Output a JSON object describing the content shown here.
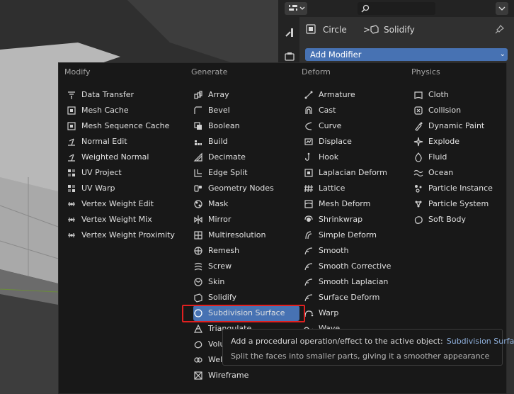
{
  "header": {
    "editor_type_icon": "properties-editor-icon",
    "search_placeholder": ""
  },
  "breadcrumb": {
    "object": "Circle",
    "separator": ">",
    "modifier": "Solidify"
  },
  "add_modifier_label": "Add Modifier",
  "menu": {
    "columns": [
      {
        "header": "Modify",
        "items": [
          {
            "label": "Data Transfer",
            "icon": "data-transfer-icon"
          },
          {
            "label": "Mesh Cache",
            "icon": "mesh-cache-icon"
          },
          {
            "label": "Mesh Sequence Cache",
            "icon": "mesh-sequence-cache-icon"
          },
          {
            "label": "Normal Edit",
            "icon": "normal-edit-icon"
          },
          {
            "label": "Weighted Normal",
            "icon": "weighted-normal-icon"
          },
          {
            "label": "UV Project",
            "icon": "uv-project-icon"
          },
          {
            "label": "UV Warp",
            "icon": "uv-warp-icon"
          },
          {
            "label": "Vertex Weight Edit",
            "icon": "vertex-weight-icon"
          },
          {
            "label": "Vertex Weight Mix",
            "icon": "vertex-weight-icon"
          },
          {
            "label": "Vertex Weight Proximity",
            "icon": "vertex-weight-icon"
          }
        ]
      },
      {
        "header": "Generate",
        "items": [
          {
            "label": "Array",
            "icon": "array-icon"
          },
          {
            "label": "Bevel",
            "icon": "bevel-icon"
          },
          {
            "label": "Boolean",
            "icon": "boolean-icon"
          },
          {
            "label": "Build",
            "icon": "build-icon"
          },
          {
            "label": "Decimate",
            "icon": "decimate-icon"
          },
          {
            "label": "Edge Split",
            "icon": "edge-split-icon"
          },
          {
            "label": "Geometry Nodes",
            "icon": "geometry-nodes-icon"
          },
          {
            "label": "Mask",
            "icon": "mask-icon"
          },
          {
            "label": "Mirror",
            "icon": "mirror-icon"
          },
          {
            "label": "Multiresolution",
            "icon": "multiresolution-icon"
          },
          {
            "label": "Remesh",
            "icon": "remesh-icon"
          },
          {
            "label": "Screw",
            "icon": "screw-icon"
          },
          {
            "label": "Skin",
            "icon": "skin-icon"
          },
          {
            "label": "Solidify",
            "icon": "solidify-icon"
          },
          {
            "label": "Subdivision Surface",
            "icon": "subdivision-surface-icon",
            "active": true
          },
          {
            "label": "Triangulate",
            "icon": "triangulate-icon"
          },
          {
            "label": "Volume to Mesh",
            "icon": "volume-to-mesh-icon"
          },
          {
            "label": "Weld",
            "icon": "weld-icon"
          },
          {
            "label": "Wireframe",
            "icon": "wireframe-icon"
          }
        ]
      },
      {
        "header": "Deform",
        "items": [
          {
            "label": "Armature",
            "icon": "armature-icon"
          },
          {
            "label": "Cast",
            "icon": "cast-icon"
          },
          {
            "label": "Curve",
            "icon": "curve-icon"
          },
          {
            "label": "Displace",
            "icon": "displace-icon"
          },
          {
            "label": "Hook",
            "icon": "hook-icon"
          },
          {
            "label": "Laplacian Deform",
            "icon": "laplacian-deform-icon"
          },
          {
            "label": "Lattice",
            "icon": "lattice-icon"
          },
          {
            "label": "Mesh Deform",
            "icon": "mesh-deform-icon"
          },
          {
            "label": "Shrinkwrap",
            "icon": "shrinkwrap-icon"
          },
          {
            "label": "Simple Deform",
            "icon": "simple-deform-icon"
          },
          {
            "label": "Smooth",
            "icon": "smooth-icon"
          },
          {
            "label": "Smooth Corrective",
            "icon": "smooth-icon"
          },
          {
            "label": "Smooth Laplacian",
            "icon": "smooth-icon"
          },
          {
            "label": "Surface Deform",
            "icon": "smooth-icon"
          },
          {
            "label": "Warp",
            "icon": "warp-icon"
          },
          {
            "label": "Wave",
            "icon": "wave-icon"
          }
        ]
      },
      {
        "header": "Physics",
        "items": [
          {
            "label": "Cloth",
            "icon": "cloth-icon"
          },
          {
            "label": "Collision",
            "icon": "collision-icon"
          },
          {
            "label": "Dynamic Paint",
            "icon": "dynamic-paint-icon"
          },
          {
            "label": "Explode",
            "icon": "explode-icon"
          },
          {
            "label": "Fluid",
            "icon": "fluid-icon"
          },
          {
            "label": "Ocean",
            "icon": "ocean-icon"
          },
          {
            "label": "Particle Instance",
            "icon": "particle-instance-icon"
          },
          {
            "label": "Particle System",
            "icon": "particle-system-icon"
          },
          {
            "label": "Soft Body",
            "icon": "soft-body-icon"
          }
        ]
      }
    ]
  },
  "tooltip": {
    "text": "Add a procedural operation/effect to the active object:",
    "name": "Subdivision Surface",
    "description": "Split the faces into smaller parts, giving it a smoother appearance"
  },
  "colors": {
    "accent": "#4772b3",
    "highlight_box": "#e02020",
    "menu_bg": "#181818"
  }
}
